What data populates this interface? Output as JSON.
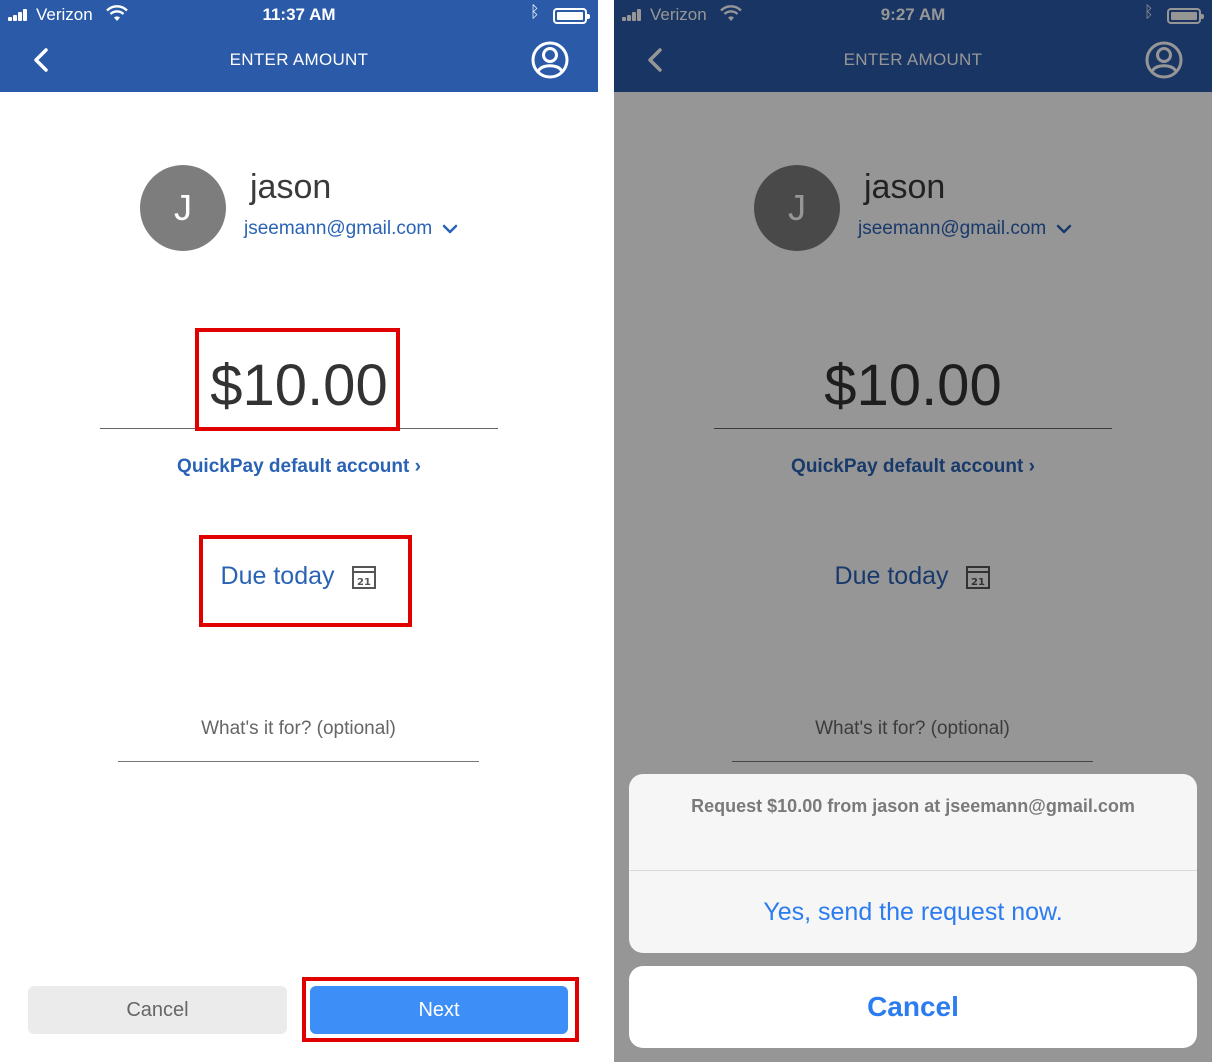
{
  "left": {
    "status": {
      "carrier": "Verizon",
      "time": "11:37 AM"
    },
    "nav": {
      "title": "ENTER AMOUNT"
    },
    "recipient": {
      "initial": "J",
      "name": "jason",
      "email": "jseemann@gmail.com"
    },
    "amount": "$10.00",
    "account_link": "QuickPay default account",
    "due_label": "Due today",
    "calendar_day": "21",
    "memo_placeholder": "What's it for? (optional)",
    "buttons": {
      "cancel": "Cancel",
      "next": "Next"
    }
  },
  "right": {
    "status": {
      "carrier": "Verizon",
      "time": "9:27 AM"
    },
    "nav": {
      "title": "ENTER AMOUNT"
    },
    "recipient": {
      "initial": "J",
      "name": "jason",
      "email": "jseemann@gmail.com"
    },
    "amount": "$10.00",
    "account_link": "QuickPay default account",
    "due_label": "Due today",
    "calendar_day": "21",
    "memo_placeholder": "What's it for? (optional)",
    "action_sheet": {
      "title": "Request $10.00 from jason at jseemann@gmail.com",
      "confirm": "Yes, send the request now.",
      "cancel": "Cancel"
    }
  },
  "colors": {
    "header": "#2a5aa8",
    "link": "#2a63b5",
    "primary_button": "#3d8ef7",
    "highlight": "#e00000",
    "ios_action": "#2b7cf0"
  }
}
